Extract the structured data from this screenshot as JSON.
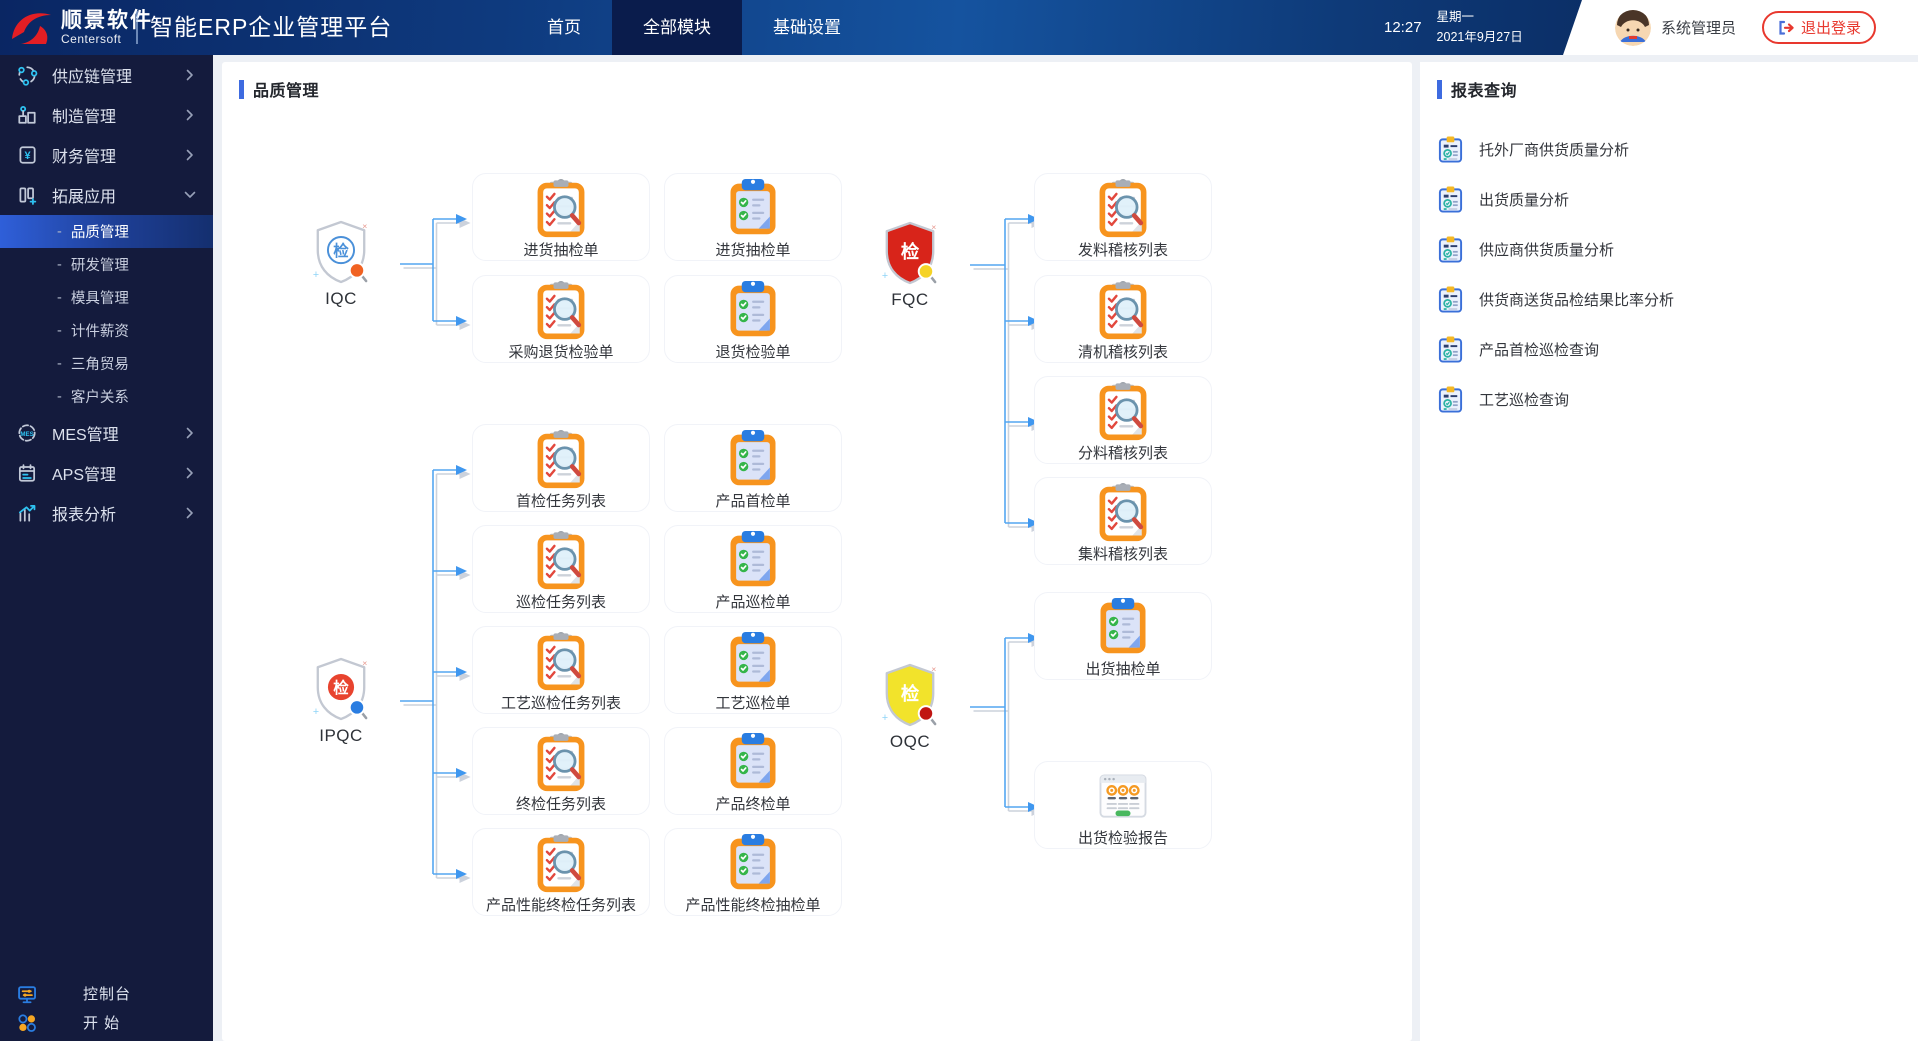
{
  "topbar": {
    "logo": {
      "name": "顺景软件",
      "sub": "Centersoft"
    },
    "title": "智能ERP企业管理平台",
    "nav": [
      {
        "key": "home",
        "label": "首页",
        "active": false
      },
      {
        "key": "all-modules",
        "label": "全部模块",
        "active": true
      },
      {
        "key": "basic-settings",
        "label": "基础设置",
        "active": false
      }
    ],
    "time": "12:27",
    "weekday": "星期一",
    "date": "2021年9月27日",
    "user": "系统管理员",
    "logout_label": "退出登录"
  },
  "sidebar": {
    "items": [
      {
        "key": "supply-chain",
        "label": "供应链管理",
        "icon": "supply-chain-icon",
        "chevron": "right"
      },
      {
        "key": "manufacturing",
        "label": "制造管理",
        "icon": "manufacturing-icon",
        "chevron": "right"
      },
      {
        "key": "finance",
        "label": "财务管理",
        "icon": "finance-icon",
        "chevron": "right"
      },
      {
        "key": "expansion",
        "label": "拓展应用",
        "icon": "expansion-icon",
        "chevron": "down",
        "expanded": true,
        "children": [
          {
            "key": "quality",
            "label": "品质管理",
            "active": true
          },
          {
            "key": "rnd",
            "label": "研发管理",
            "active": false
          },
          {
            "key": "mold",
            "label": "模具管理",
            "active": false
          },
          {
            "key": "piecework",
            "label": "计件薪资",
            "active": false
          },
          {
            "key": "triangle-trade",
            "label": "三角贸易",
            "active": false
          },
          {
            "key": "customer",
            "label": "客户关系",
            "active": false
          }
        ]
      },
      {
        "key": "mes",
        "label": "MES管理",
        "icon": "mes-icon",
        "chevron": "right"
      },
      {
        "key": "aps",
        "label": "APS管理",
        "icon": "aps-icon",
        "chevron": "right"
      },
      {
        "key": "report-analysis",
        "label": "报表分析",
        "icon": "report-analysis-icon",
        "chevron": "right"
      }
    ],
    "footer": [
      {
        "key": "console",
        "label": "控制台",
        "icon": "console-icon"
      },
      {
        "key": "start",
        "label": "开 始",
        "icon": "start-icon"
      }
    ]
  },
  "main": {
    "title": "品质管理",
    "flow": {
      "qc_nodes": [
        {
          "id": "IQC",
          "label": "IQC",
          "style": "iqc"
        },
        {
          "id": "FQC",
          "label": "FQC",
          "style": "fqc"
        },
        {
          "id": "IPQC",
          "label": "IPQC",
          "style": "ipqc"
        },
        {
          "id": "OQC",
          "label": "OQC",
          "style": "oqc"
        }
      ],
      "doc_nodes": [
        {
          "id": "iqc_a1",
          "label": "进货抽检单",
          "icon": "audit-clipboard-icon"
        },
        {
          "id": "iqc_a2",
          "label": "采购退货检验单",
          "icon": "audit-clipboard-icon"
        },
        {
          "id": "iqc_b1",
          "label": "进货抽检单",
          "icon": "form-clipboard-icon"
        },
        {
          "id": "iqc_b2",
          "label": "退货检验单",
          "icon": "form-clipboard-icon"
        },
        {
          "id": "fqc_1",
          "label": "发料稽核列表",
          "icon": "audit-clipboard-icon"
        },
        {
          "id": "fqc_2",
          "label": "清机稽核列表",
          "icon": "audit-clipboard-icon"
        },
        {
          "id": "fqc_3",
          "label": "分料稽核列表",
          "icon": "audit-clipboard-icon"
        },
        {
          "id": "fqc_4",
          "label": "集料稽核列表",
          "icon": "audit-clipboard-icon"
        },
        {
          "id": "ipqc_a1",
          "label": "首检任务列表",
          "icon": "audit-clipboard-icon"
        },
        {
          "id": "ipqc_a2",
          "label": "巡检任务列表",
          "icon": "audit-clipboard-icon"
        },
        {
          "id": "ipqc_a3",
          "label": "工艺巡检任务列表",
          "icon": "audit-clipboard-icon"
        },
        {
          "id": "ipqc_a4",
          "label": "终检任务列表",
          "icon": "audit-clipboard-icon"
        },
        {
          "id": "ipqc_a5",
          "label": "产品性能终检任务列表",
          "icon": "audit-clipboard-icon"
        },
        {
          "id": "ipqc_b1",
          "label": "产品首检单",
          "icon": "form-clipboard-icon"
        },
        {
          "id": "ipqc_b2",
          "label": "产品巡检单",
          "icon": "form-clipboard-icon"
        },
        {
          "id": "ipqc_b3",
          "label": "工艺巡检单",
          "icon": "form-clipboard-icon"
        },
        {
          "id": "ipqc_b4",
          "label": "产品终检单",
          "icon": "form-clipboard-icon"
        },
        {
          "id": "ipqc_b5",
          "label": "产品性能终检抽检单",
          "icon": "form-clipboard-icon"
        },
        {
          "id": "oqc_1",
          "label": "出货抽检单",
          "icon": "form-clipboard-icon"
        },
        {
          "id": "oqc_2",
          "label": "出货检验报告",
          "icon": "report-window-icon"
        }
      ]
    }
  },
  "reports": {
    "title": "报表查询",
    "items": [
      "托外厂商供货质量分析",
      "出货质量分析",
      "供应商供货质量分析",
      "供货商送货品检结果比率分析",
      "产品首检巡检查询",
      "工艺巡检查询"
    ]
  },
  "colors": {
    "connector_blue": "#53a6f1",
    "topbar_active": "#0a1c4c",
    "sidebar_active": "#2f5fd9",
    "clipboard_orange": "#f7941e",
    "shield_fqc_red": "#d8241a",
    "shield_oqc_yellow": "#f2e32b",
    "shield_ipqc_badge": "#e8432e",
    "shield_iqc_mark": "#4a90d9",
    "logout_red": "#e8382e",
    "title_bar_blue": "#3e6be0"
  }
}
